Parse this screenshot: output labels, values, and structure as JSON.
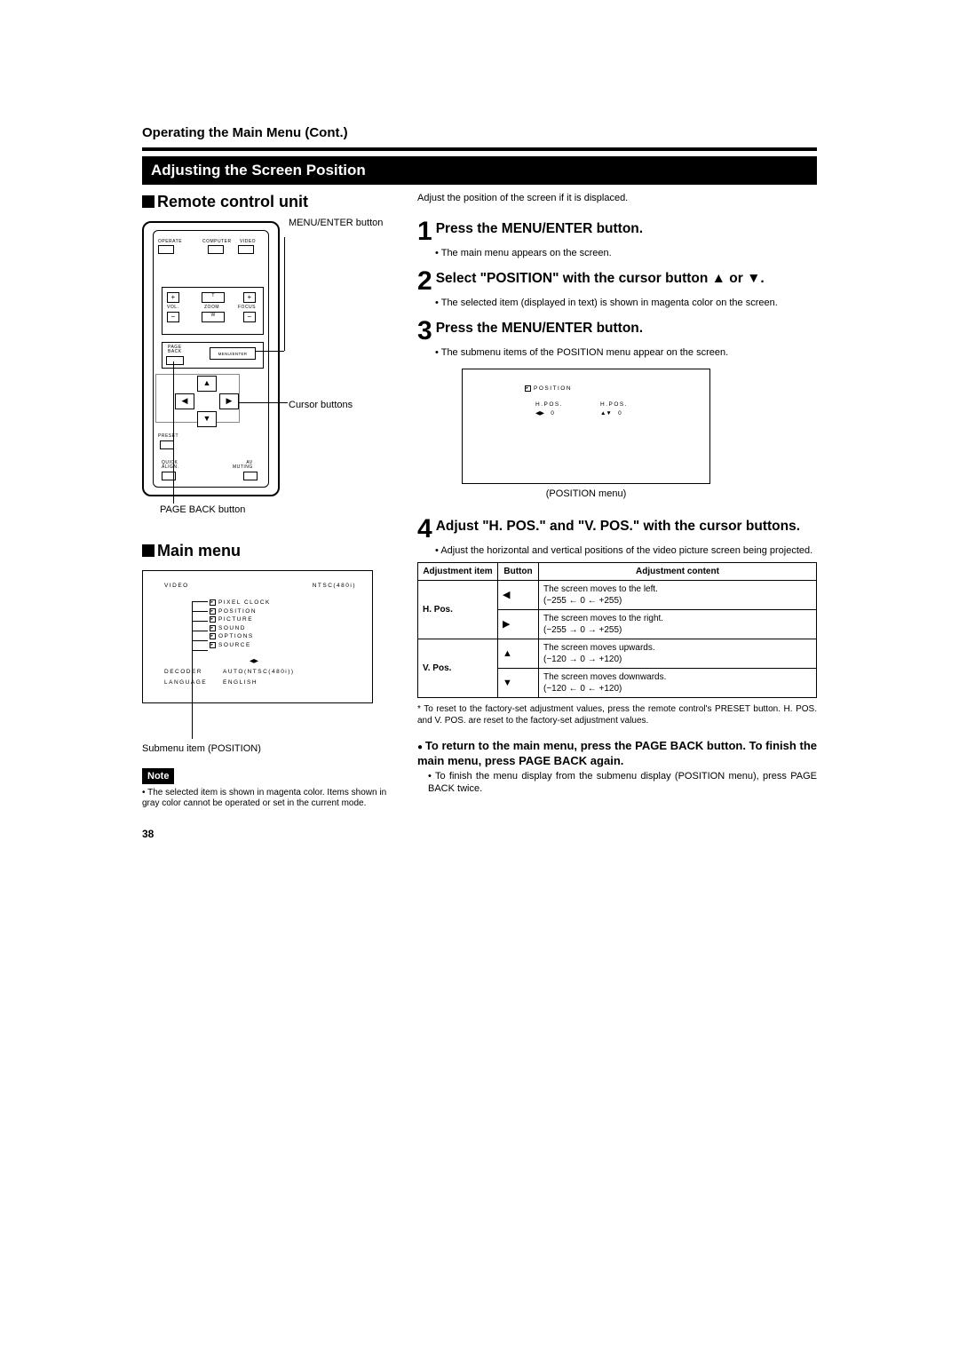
{
  "page": {
    "header": "Operating the Main Menu (Cont.)",
    "title_bar": "Adjusting the Screen Position",
    "page_number": "38"
  },
  "left": {
    "remote_heading": "Remote control unit",
    "mainmenu_heading": "Main menu",
    "callout_menu_enter": "MENU/ENTER button",
    "callout_cursor": "Cursor buttons",
    "callout_pageback": "PAGE BACK button",
    "callout_submenu": "Submenu item (POSITION)",
    "note_label": "Note",
    "note_text": "The selected item is shown in magenta color. Items shown in gray color cannot be operated or set in the current mode.",
    "remote": {
      "operate": "OPERATE",
      "computer": "COMPUTER",
      "video": "VIDEO",
      "vol": "VOL.",
      "zoom": "ZOOM",
      "focus": "FOCUS",
      "t": "T",
      "w": "W",
      "plus": "+",
      "minus": "−",
      "pageback": "PAGE BACK",
      "menuenter": "MENU/ENTER",
      "preset": "PRESET",
      "quickalign": "QUICK ALIGN.",
      "avmuting": "AV MUTING"
    },
    "osd": {
      "header_left": "VIDEO",
      "header_right": "NTSC(480i)",
      "items": [
        "PIXEL CLOCK",
        "POSITION",
        "PICTURE",
        "SOUND",
        "OPTIONS",
        "SOURCE"
      ],
      "decoder_label": "DECODER",
      "decoder_value": "AUTO(NTSC(480i))",
      "language_label": "LANGUAGE",
      "language_value": "ENGLISH",
      "arrows": "◀▶"
    }
  },
  "right": {
    "intro": "Adjust the position of the screen if it is displaced.",
    "steps": [
      {
        "num": "1",
        "title": "Press the MENU/ENTER button.",
        "body": "The main menu appears on the screen."
      },
      {
        "num": "2",
        "title": "Select \"POSITION\" with the cursor button ▲ or ▼.",
        "body": "The selected item (displayed in text) is shown in magenta color on the screen."
      },
      {
        "num": "3",
        "title": "Press the MENU/ENTER button.",
        "body": "The submenu items of the POSITION menu appear on the screen."
      },
      {
        "num": "4",
        "title": "Adjust \"H. POS.\" and \"V. POS.\" with the cursor buttons.",
        "body": "Adjust the horizontal and vertical positions of the video picture screen being projected."
      }
    ],
    "pos_menu": {
      "title": "POSITION",
      "hpos_label": "H.POS.",
      "hpos_arrows": "◀▶",
      "hpos_val": "0",
      "vpos_label": "H.POS.",
      "vpos_arrows": "▲▼",
      "vpos_val": "0",
      "caption": "(POSITION menu)"
    },
    "table": {
      "head_item": "Adjustment item",
      "head_button": "Button",
      "head_content": "Adjustment content",
      "rows": [
        {
          "item": "H. Pos.",
          "btn": "◀",
          "content": "The screen moves to the left.\n(−255 ← 0 ← +255)"
        },
        {
          "item": "",
          "btn": "▶",
          "content": "The screen moves to the right.\n(−255 → 0 → +255)"
        },
        {
          "item": "V. Pos.",
          "btn": "▲",
          "content": "The screen moves upwards.\n(−120 → 0 → +120)"
        },
        {
          "item": "",
          "btn": "▼",
          "content": "The screen moves downwards.\n(−120 ← 0 ← +120)"
        }
      ]
    },
    "reset_note": "* To reset to the factory-set adjustment values, press the remote control's PRESET button. H. POS. and V. POS. are reset to the factory-set adjustment values.",
    "return_heading": "To return to the main menu, press the PAGE BACK button. To finish the main menu, press PAGE BACK again.",
    "return_body": "To finish the menu display from the submenu display (POSITION menu), press PAGE BACK twice."
  }
}
